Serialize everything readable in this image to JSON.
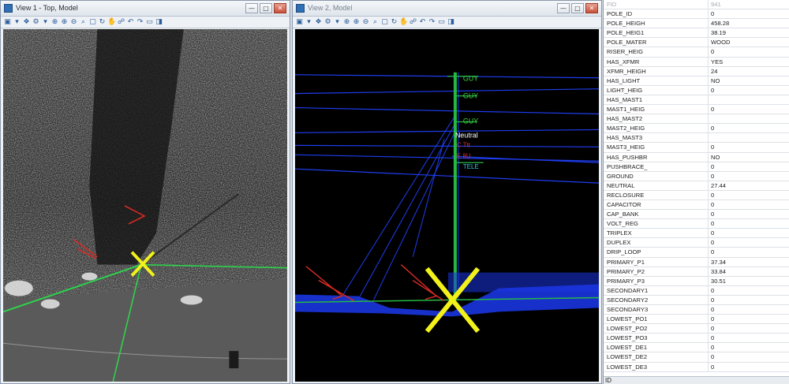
{
  "view1": {
    "title": "View 1 - Top, Model",
    "controls": {
      "minimize": "—",
      "maximize": "□",
      "close": "✕"
    }
  },
  "view2": {
    "title": "View 2, Model",
    "controls": {
      "minimize": "—",
      "maximize": "□",
      "close": "✕"
    },
    "labels": {
      "guy1": "GUY",
      "guy2": "GUY",
      "guy3": "GUY",
      "neutral": "Neutral",
      "red1": "C Ttt",
      "red2": "E 8U",
      "tele": "TELE"
    }
  },
  "toolbar_icons": [
    "view-icon",
    "dropdown-icon",
    "layers-icon",
    "settings-icon",
    "dropdown-icon",
    "zoom-fit-icon",
    "zoom-in-icon",
    "zoom-out-icon",
    "zoom-window-icon",
    "fit-view-icon",
    "rotate-icon",
    "pan-icon",
    "walk-icon",
    "previous-view-icon",
    "next-view-icon",
    "camera-icon",
    "display-style-icon"
  ],
  "toolbar_glyphs": [
    "▣",
    "▾",
    "❖",
    "⚙",
    "▾",
    "⊕",
    "⊕",
    "⊖",
    "⌕",
    "▢",
    "↻",
    "✋",
    "☍",
    "↶",
    "↷",
    "▭",
    "◨"
  ],
  "attributes": {
    "rows": [
      {
        "key": "FID",
        "value": "941",
        "dim": true
      },
      {
        "key": "POLE_ID",
        "value": "0"
      },
      {
        "key": "POLE_HEIGH",
        "value": "458.28"
      },
      {
        "key": "POLE_HEIG1",
        "value": "38.19"
      },
      {
        "key": "POLE_MATER",
        "value": "WOOD"
      },
      {
        "key": "RISER_HEIG",
        "value": "0"
      },
      {
        "key": "HAS_XFMR",
        "value": "YES"
      },
      {
        "key": "XFMR_HEIGH",
        "value": "24"
      },
      {
        "key": "HAS_LIGHT",
        "value": "NO"
      },
      {
        "key": "LIGHT_HEIG",
        "value": "0"
      },
      {
        "key": "HAS_MAST1",
        "value": ""
      },
      {
        "key": "MAST1_HEIG",
        "value": "0"
      },
      {
        "key": "HAS_MAST2",
        "value": ""
      },
      {
        "key": "MAST2_HEIG",
        "value": "0"
      },
      {
        "key": "HAS_MAST3",
        "value": ""
      },
      {
        "key": "MAST3_HEIG",
        "value": "0"
      },
      {
        "key": "HAS_PUSHBR",
        "value": "NO"
      },
      {
        "key": "PUSHBRACE_",
        "value": "0"
      },
      {
        "key": "GROUND",
        "value": "0"
      },
      {
        "key": "NEUTRAL",
        "value": "27.44"
      },
      {
        "key": "RECLOSURE",
        "value": "0"
      },
      {
        "key": "CAPACITOR",
        "value": "0"
      },
      {
        "key": "CAP_BANK",
        "value": "0"
      },
      {
        "key": "VOLT_REG",
        "value": "0"
      },
      {
        "key": "TRIPLEX",
        "value": "0"
      },
      {
        "key": "DUPLEX",
        "value": "0"
      },
      {
        "key": "DRIP_LOOP",
        "value": "0"
      },
      {
        "key": "PRIMARY_P1",
        "value": "37.34"
      },
      {
        "key": "PRIMARY_P2",
        "value": "33.84"
      },
      {
        "key": "PRIMARY_P3",
        "value": "30.51"
      },
      {
        "key": "SECONDARY1",
        "value": "0"
      },
      {
        "key": "SECONDARY2",
        "value": "0"
      },
      {
        "key": "SECONDARY3",
        "value": "0"
      },
      {
        "key": "LOWEST_PO1",
        "value": "0"
      },
      {
        "key": "LOWEST_PO2",
        "value": "0"
      },
      {
        "key": "LOWEST_PO3",
        "value": "0"
      },
      {
        "key": "LOWEST_DE1",
        "value": "0"
      },
      {
        "key": "LOWEST_DE2",
        "value": "0"
      },
      {
        "key": "LOWEST_DE3",
        "value": "0"
      }
    ],
    "footer": "ID"
  },
  "colors": {
    "marker": "#f2f21a",
    "guy_label": "#3cd23c",
    "wire": "#1f3df0",
    "pole": "#26b845",
    "arrow": "#d42a22",
    "canvas2_bg": "#000000"
  }
}
